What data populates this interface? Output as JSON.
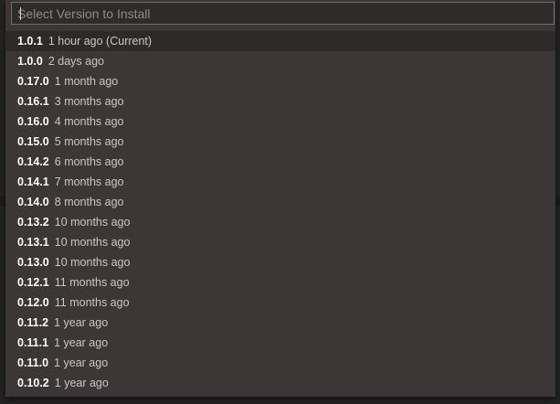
{
  "quick_pick": {
    "placeholder": "Select Version to Install",
    "value": "",
    "items": [
      {
        "version": "1.0.1",
        "age": "1 hour ago (Current)",
        "active": true
      },
      {
        "version": "1.0.0",
        "age": "2 days ago"
      },
      {
        "version": "0.17.0",
        "age": "1 month ago"
      },
      {
        "version": "0.16.1",
        "age": "3 months ago"
      },
      {
        "version": "0.16.0",
        "age": "4 months ago"
      },
      {
        "version": "0.15.0",
        "age": "5 months ago"
      },
      {
        "version": "0.14.2",
        "age": "6 months ago"
      },
      {
        "version": "0.14.1",
        "age": "7 months ago"
      },
      {
        "version": "0.14.0",
        "age": "8 months ago"
      },
      {
        "version": "0.13.2",
        "age": "10 months ago"
      },
      {
        "version": "0.13.1",
        "age": "10 months ago"
      },
      {
        "version": "0.13.0",
        "age": "10 months ago"
      },
      {
        "version": "0.12.1",
        "age": "11 months ago"
      },
      {
        "version": "0.12.0",
        "age": "11 months ago"
      },
      {
        "version": "0.11.2",
        "age": "1 year ago"
      },
      {
        "version": "0.11.1",
        "age": "1 year ago"
      },
      {
        "version": "0.11.0",
        "age": "1 year ago"
      },
      {
        "version": "0.10.2",
        "age": "1 year ago"
      }
    ]
  },
  "colors": {
    "palette_bg": "#3c3736",
    "active_row_bg": "#2d2a29",
    "version_text": "#ffffff",
    "age_text": "#c9c6c4"
  }
}
